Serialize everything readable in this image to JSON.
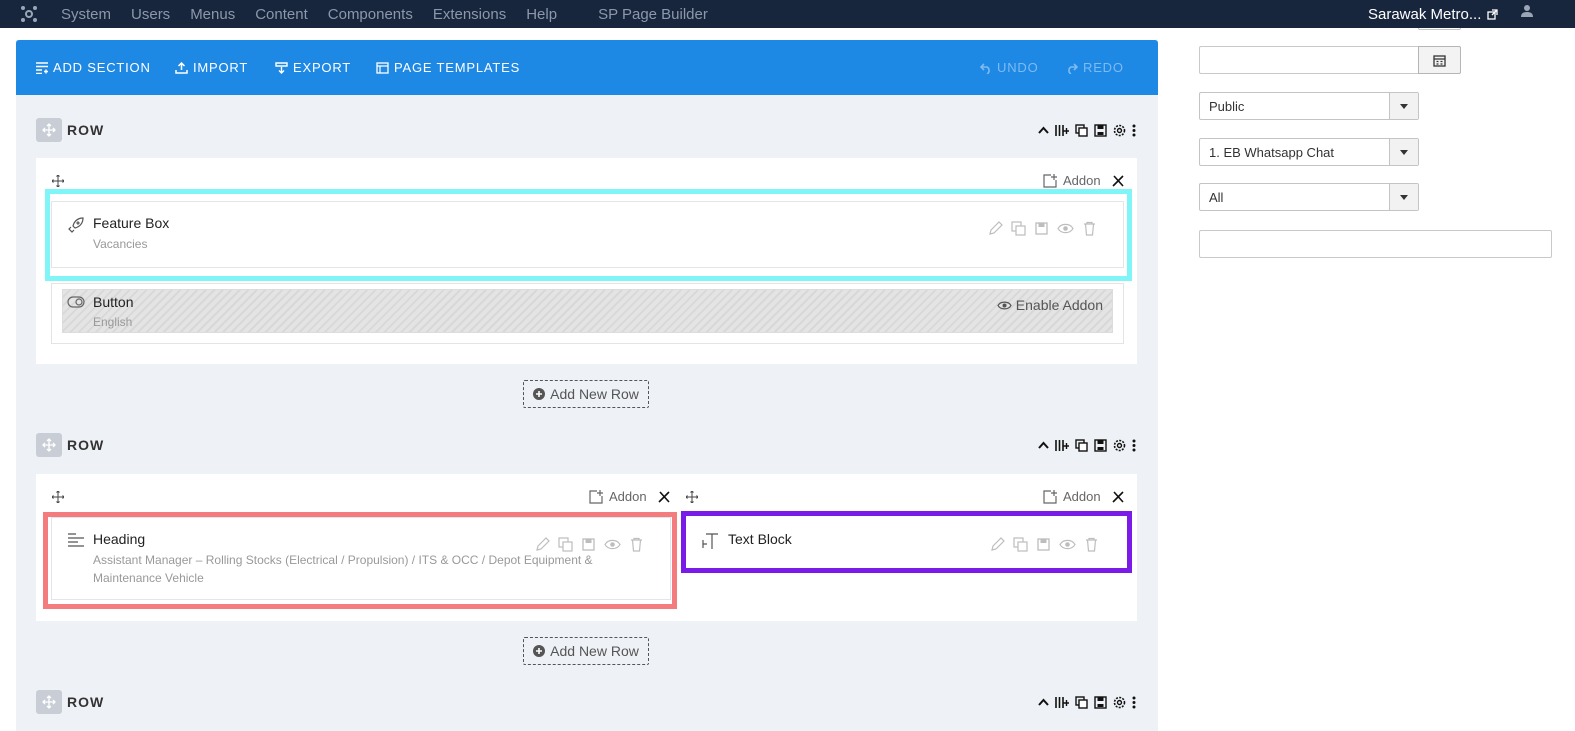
{
  "topnav": {
    "menu": [
      "System",
      "Users",
      "Menus",
      "Content",
      "Components",
      "Extensions",
      "Help"
    ],
    "page_builder": "SP Page Builder",
    "site_name": "Sarawak Metro..."
  },
  "toolbar": {
    "add_section": "ADD SECTION",
    "import": "IMPORT",
    "export": "EXPORT",
    "page_templates": "PAGE TEMPLATES",
    "undo": "UNDO",
    "redo": "REDO"
  },
  "rows": [
    {
      "title": "ROW"
    },
    {
      "title": "ROW"
    },
    {
      "title": "ROW"
    }
  ],
  "addon_label": "Addon",
  "add_new_row": "Add New Row",
  "addons": {
    "feature_box": {
      "name": "Feature Box",
      "sub": "Vacancies"
    },
    "button": {
      "name": "Button",
      "sub": "English",
      "enable": "Enable Addon"
    },
    "heading": {
      "name": "Heading",
      "sub": "Assistant Manager – Rolling Stocks (Electrical / Propulsion) / ITS & OCC / Depot Equipment & Maintenance Vehicle"
    },
    "text_block": {
      "name": "Text Block"
    }
  },
  "sidebar": {
    "date_value": "",
    "access": "Public",
    "module": "1. EB Whatsapp Chat",
    "language": "All",
    "note_value": ""
  },
  "colors": {
    "nav_bg": "#17253d",
    "toolbar_bg": "#1e88e5",
    "highlight_cyan": "#7ff5f7",
    "highlight_red": "#f47c7e",
    "highlight_purple": "#7a1be8"
  }
}
